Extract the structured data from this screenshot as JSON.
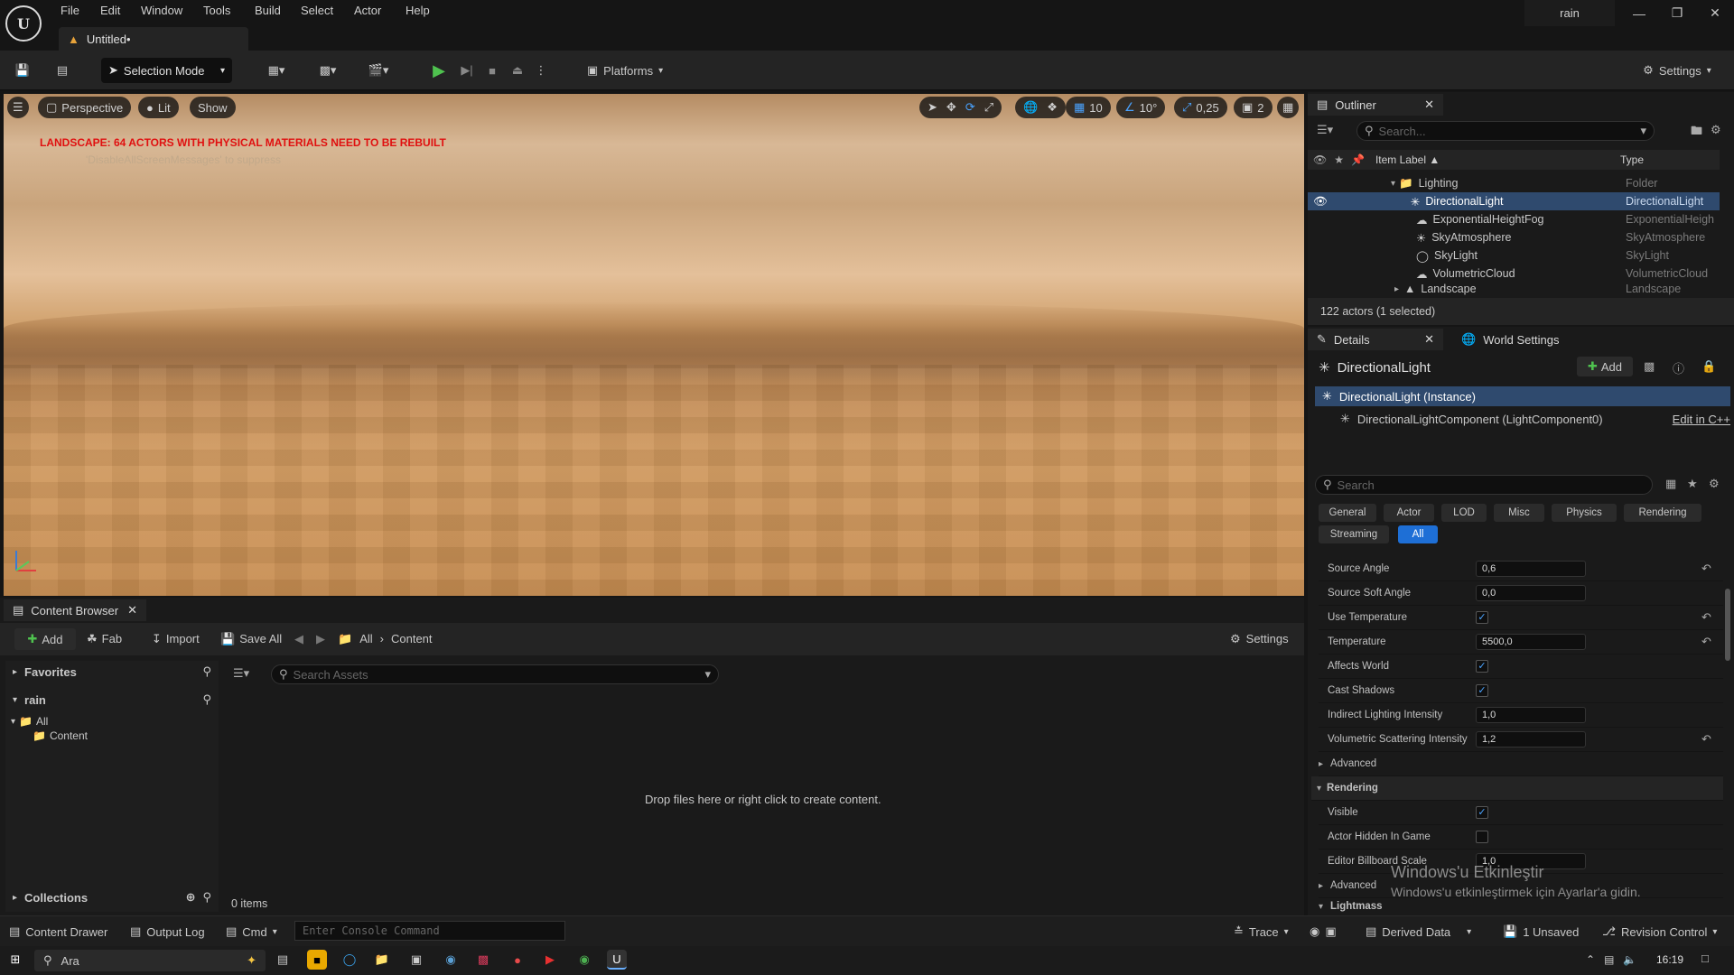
{
  "menu": {
    "items": [
      "File",
      "Edit",
      "Window",
      "Tools",
      "Build",
      "Select",
      "Actor",
      "Help"
    ]
  },
  "document_tab": {
    "title": "Untitled•"
  },
  "project_name": "rain",
  "toolbar": {
    "selection_mode": "Selection Mode",
    "platforms": "Platforms",
    "settings": "Settings"
  },
  "viewport": {
    "perspective": "Perspective",
    "lit": "Lit",
    "show": "Show",
    "grid_snap": "10",
    "rot_snap": "10°",
    "scale_snap": "0,25",
    "camera_speed": "2",
    "warning": "LANDSCAPE: 64 ACTORS WITH PHYSICAL MATERIALS NEED TO BE REBUILT",
    "suppress_hint": "'DisableAllScreenMessages' to suppress"
  },
  "outliner": {
    "tab": "Outliner",
    "search_placeholder": "Search...",
    "col_label": "Item Label ▲",
    "col_type": "Type",
    "rows": [
      {
        "label": "Lighting",
        "type": "Folder"
      },
      {
        "label": "DirectionalLight",
        "type": "DirectionalLight"
      },
      {
        "label": "ExponentialHeightFog",
        "type": "ExponentialHeigh"
      },
      {
        "label": "SkyAtmosphere",
        "type": "SkyAtmosphere"
      },
      {
        "label": "SkyLight",
        "type": "SkyLight"
      },
      {
        "label": "VolumetricCloud",
        "type": "VolumetricCloud"
      },
      {
        "label": "Landscape",
        "type": "Landscape"
      }
    ],
    "status": "122 actors (1 selected)"
  },
  "details": {
    "tab": "Details",
    "world_settings_tab": "World Settings",
    "actor_name": "DirectionalLight",
    "add": "Add",
    "instance": "DirectionalLight (Instance)",
    "component": "DirectionalLightComponent (LightComponent0)",
    "edit_cpp": "Edit in C++",
    "search_placeholder": "Search",
    "filters": [
      "General",
      "Actor",
      "LOD",
      "Misc",
      "Physics",
      "Rendering",
      "Streaming",
      "All"
    ],
    "props": [
      {
        "label": "Source Angle",
        "value": "0,6",
        "reset": true
      },
      {
        "label": "Source Soft Angle",
        "value": "0,0",
        "reset": false
      },
      {
        "label": "Use Temperature",
        "check": true,
        "reset": true
      },
      {
        "label": "Temperature",
        "value": "5500,0",
        "reset": true
      },
      {
        "label": "Affects World",
        "check": true,
        "reset": false
      },
      {
        "label": "Cast Shadows",
        "check": true,
        "reset": false
      },
      {
        "label": "Indirect Lighting Intensity",
        "value": "1,0",
        "reset": false
      },
      {
        "label": "Volumetric Scattering Intensity",
        "value": "1,2",
        "reset": true
      }
    ],
    "advanced": "Advanced",
    "rendering": "Rendering",
    "render_props": [
      {
        "label": "Visible",
        "check": true
      },
      {
        "label": "Actor Hidden In Game",
        "check": false
      },
      {
        "label": "Editor Billboard Scale",
        "value": "1,0"
      }
    ],
    "advanced2": "Advanced",
    "lightmass": "Lightmass"
  },
  "content_browser": {
    "tab": "Content Browser",
    "add": "Add",
    "fab": "Fab",
    "import": "Import",
    "save_all": "Save All",
    "crumb_all": "All",
    "crumb_content": "Content",
    "settings": "Settings",
    "favorites": "Favorites",
    "project": "rain",
    "tree_all": "All",
    "tree_content": "Content",
    "search_placeholder": "Search Assets",
    "empty_msg": "Drop files here or right click to create content.",
    "collections": "Collections",
    "items_count": "0 items"
  },
  "statusbar": {
    "content_drawer": "Content Drawer",
    "output_log": "Output Log",
    "cmd": "Cmd",
    "console_placeholder": "Enter Console Command",
    "trace": "Trace",
    "derived_data": "Derived Data",
    "unsaved": "1 Unsaved",
    "revision": "Revision Control"
  },
  "windows": {
    "watermark_title": "Windows'u Etkinleştir",
    "watermark_sub": "Windows'u etkinleştirmek için Ayarlar'a gidin.",
    "search": "Ara",
    "clock": "16:19"
  }
}
